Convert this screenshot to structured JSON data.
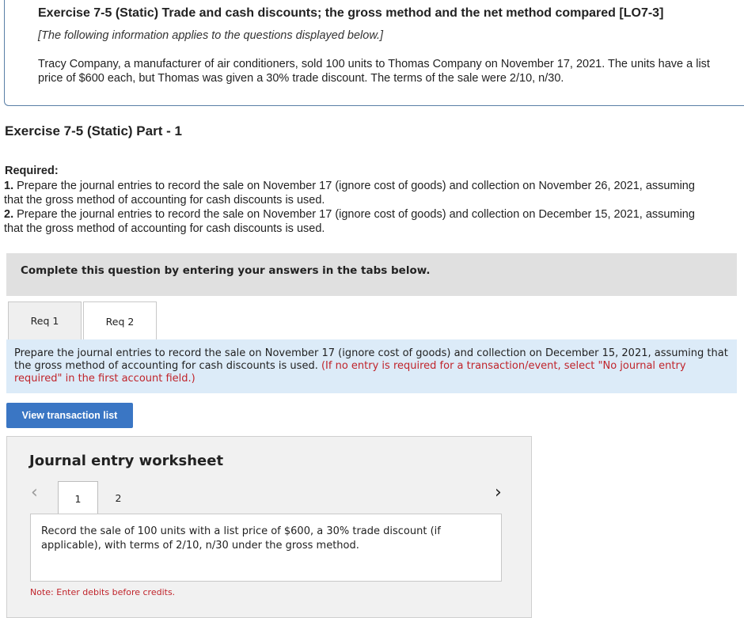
{
  "exercise": {
    "title": "Exercise 7-5 (Static) Trade and cash discounts; the gross method and the net method compared [LO7-3]",
    "subtitle": "[The following information applies to the questions displayed below.]",
    "description": "Tracy Company, a manufacturer of air conditioners, sold 100 units to Thomas Company on November 17, 2021. The units have a list price of $600 each, but Thomas was given a 30% trade discount. The terms of the sale were 2/10, n/30."
  },
  "part": {
    "title": "Exercise 7-5 (Static) Part - 1",
    "required_label": "Required:",
    "items": [
      {
        "num": "1.",
        "text": "Prepare the journal entries to record the sale on November 17 (ignore cost of goods) and collection on November 26, 2021, assuming that the gross method of accounting for cash discounts is used."
      },
      {
        "num": "2.",
        "text": "Prepare the journal entries to record the sale on November 17 (ignore cost of goods) and collection on December 15, 2021, assuming that the gross method of accounting for cash discounts is used."
      }
    ]
  },
  "instructions": "Complete this question by entering your answers in the tabs below.",
  "tabs": [
    {
      "label": "Req 1",
      "active": false
    },
    {
      "label": "Req 2",
      "active": true
    }
  ],
  "panel": {
    "text": "Prepare the journal entries to record the sale on November 17 (ignore cost of goods) and collection on December 15, 2021, assuming that the gross method of accounting for cash discounts is used.",
    "note": "(If no entry is required for a transaction/event, select \"No journal entry required\" in the first account field.)"
  },
  "view_button": "View transaction list",
  "worksheet": {
    "title": "Journal entry worksheet",
    "pages": [
      "1",
      "2"
    ],
    "prev_icon": "chevron-left-icon",
    "next_icon": "chevron-right-icon",
    "description": "Record the sale of 100 units with a list price of $600, a 30% trade discount (if applicable), with terms of 2/10, n/30 under the gross method.",
    "note": "Note: Enter debits before credits."
  },
  "colors": {
    "accent_blue": "#3a76c4",
    "panel_blue": "#dcebf8",
    "instruction_red": "#c0242b"
  }
}
